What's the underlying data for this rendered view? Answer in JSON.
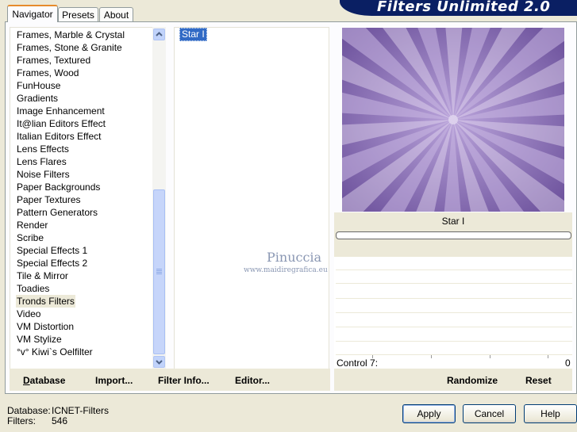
{
  "banner": {
    "title": "Filters Unlimited 2.0"
  },
  "tabs": [
    {
      "label": "Navigator",
      "active": true
    },
    {
      "label": "Presets",
      "active": false
    },
    {
      "label": "About",
      "active": false
    }
  ],
  "categories": {
    "items": [
      "Frames, Marble & Crystal",
      "Frames, Stone & Granite",
      "Frames, Textured",
      "Frames, Wood",
      "FunHouse",
      "Gradients",
      "Image Enhancement",
      "It@lian Editors Effect",
      "Italian Editors Effect",
      "Lens Effects",
      "Lens Flares",
      "Noise Filters",
      "Paper Backgrounds",
      "Paper Textures",
      "Pattern Generators",
      "Render",
      "Scribe",
      "Special Effects 1",
      "Special Effects 2",
      "Tile & Mirror",
      "Toadies",
      "Tronds Filters",
      "Video",
      "VM Distortion",
      "VM Stylize",
      "°v° Kiwi`s Oelfilter"
    ],
    "selected": "Tronds Filters"
  },
  "filters": {
    "items": [
      "Star I"
    ],
    "selected": "Star I"
  },
  "preview": {
    "filter_name": "Star I",
    "colors": {
      "light": "#c8b6e2",
      "dark": "#6a4f9a"
    }
  },
  "control": {
    "label": "Control 7:",
    "value": "0"
  },
  "toolbar": {
    "database": "Database",
    "import": "Import...",
    "filter_info": "Filter Info...",
    "editor": "Editor...",
    "randomize": "Randomize",
    "reset": "Reset"
  },
  "footer": {
    "database_label": "Database:",
    "database_value": "ICNET-Filters",
    "filters_label": "Filters:",
    "filters_value": "546"
  },
  "buttons": {
    "apply": "Apply",
    "cancel": "Cancel",
    "help": "Help"
  },
  "watermark": {
    "name": "Pinuccia",
    "site": "www.maidiregrafica.eu"
  },
  "colors": {
    "selection": "#316ac5",
    "banner": "#0a1f63",
    "tab_accent": "#e68b2c"
  }
}
